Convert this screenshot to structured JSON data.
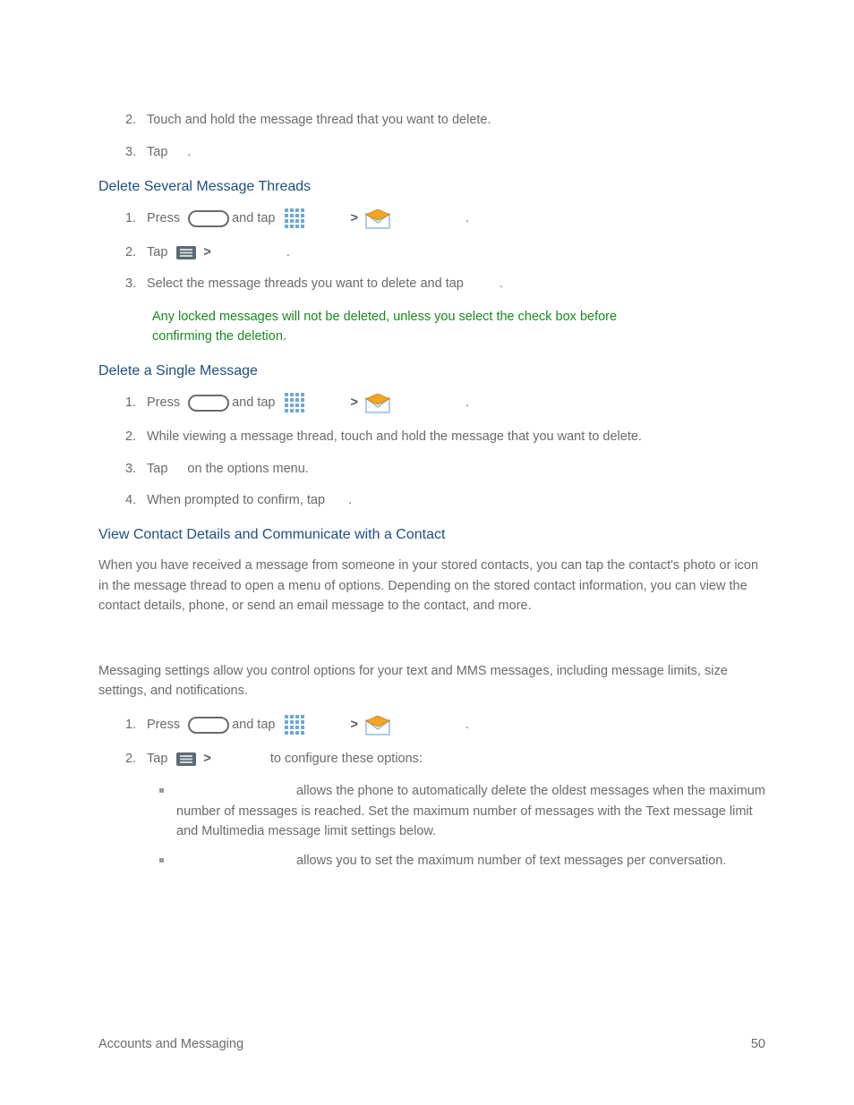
{
  "intro_list": {
    "item2": "Touch and hold the message thread that you want to delete.",
    "item3_a": "Tap",
    "item3_b": "."
  },
  "section1": {
    "heading": "Delete Several Message Threads",
    "step1_a": "Press",
    "step1_b": "and tap",
    "step1_c": ">",
    "step1_d": ".",
    "step2_a": "Tap",
    "step2_b": ">",
    "step2_c": ".",
    "step3": "Select the message threads you want to delete and tap",
    "step3_p": ".",
    "note": "Any locked messages will not be deleted, unless you select the check box before confirming the deletion."
  },
  "section2": {
    "heading": "Delete a Single Message",
    "step1_a": "Press",
    "step1_b": "and tap",
    "step1_c": ">",
    "step1_d": ".",
    "step2": "While viewing a message thread, touch and hold the message that you want to delete.",
    "step3_a": "Tap",
    "step3_b": "on the options menu.",
    "step4_a": "When prompted to confirm, tap",
    "step4_b": "."
  },
  "section3": {
    "heading": "View Contact Details and Communicate with a Contact",
    "para": "When you have received a message from someone in your stored contacts, you can tap the contact's photo or icon in the message thread to open a menu of options. Depending on the stored contact information, you can view the contact details, phone, or send an email message to the contact, and more."
  },
  "section4": {
    "para": "Messaging settings allow you control options for your text and MMS messages, including message limits, size settings, and notifications.",
    "step1_a": "Press",
    "step1_b": "and tap",
    "step1_c": ">",
    "step1_d": ".",
    "step2_a": "Tap",
    "step2_b": ">",
    "step2_c": "to configure these options:",
    "b1": "allows the phone to automatically delete the oldest messages when the maximum number of messages is reached. Set the maximum number of messages with the Text message limit and Multimedia message limit settings below.",
    "b2": "allows you to set the maximum number of text messages per conversation."
  },
  "footer": {
    "left": "Accounts and Messaging",
    "right": "50"
  }
}
